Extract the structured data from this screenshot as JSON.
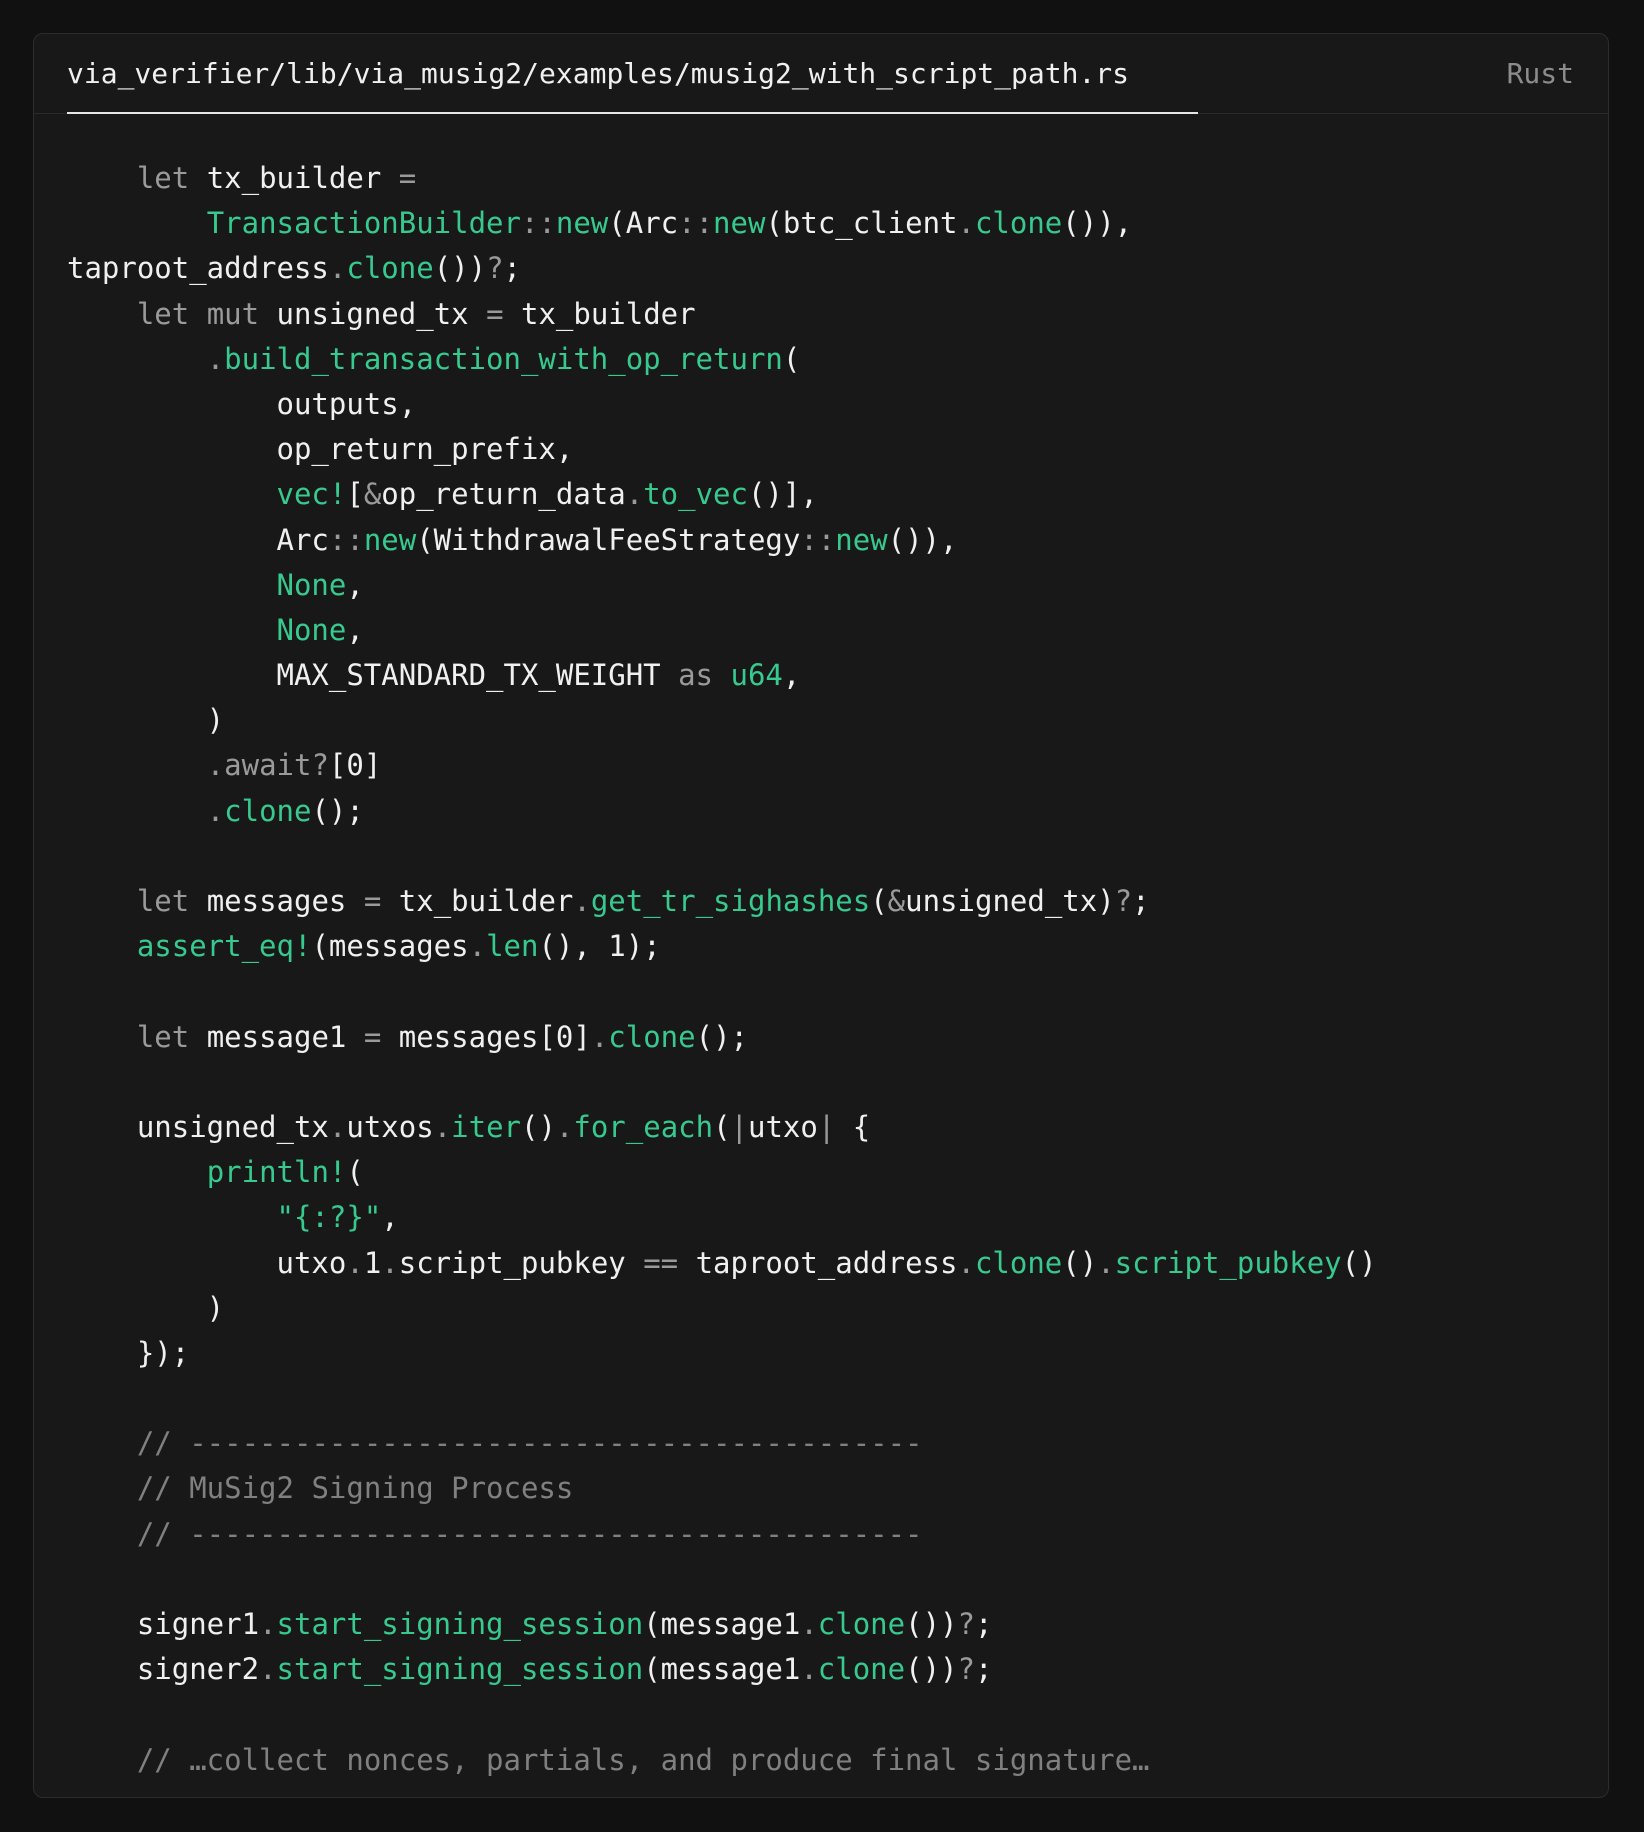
{
  "header": {
    "file_path": "via_verifier/lib/via_musig2/examples/musig2_with_script_path.rs",
    "language": "Rust"
  },
  "theme": {
    "background": "#111111",
    "panel": "#181818",
    "text": "#f0f0f0",
    "muted": "#9a9a9a",
    "accent": "#38c98e",
    "comment": "#808080"
  },
  "code_lines": [
    [
      [
        "    ",
        "t"
      ],
      [
        "let",
        "k"
      ],
      [
        " tx_builder ",
        "t"
      ],
      [
        "=",
        "p"
      ]
    ],
    [
      [
        "        ",
        "t"
      ],
      [
        "TransactionBuilder",
        "f"
      ],
      [
        "::",
        "p"
      ],
      [
        "new",
        "f"
      ],
      [
        "(Arc",
        "t"
      ],
      [
        "::",
        "p"
      ],
      [
        "new",
        "f"
      ],
      [
        "(btc_client",
        "t"
      ],
      [
        ".",
        "p"
      ],
      [
        "clone",
        "f"
      ],
      [
        "()),",
        "t"
      ]
    ],
    [
      [
        "taproot_address",
        "t"
      ],
      [
        ".",
        "p"
      ],
      [
        "clone",
        "f"
      ],
      [
        "())",
        "t"
      ],
      [
        "?",
        "p"
      ],
      [
        ";",
        "t"
      ]
    ],
    [
      [
        "    ",
        "t"
      ],
      [
        "let",
        "k"
      ],
      [
        " ",
        "t"
      ],
      [
        "mut",
        "k"
      ],
      [
        " unsigned_tx ",
        "t"
      ],
      [
        "=",
        "p"
      ],
      [
        " tx_builder",
        "t"
      ]
    ],
    [
      [
        "        ",
        "t"
      ],
      [
        ".",
        "p"
      ],
      [
        "build_transaction_with_op_return",
        "f"
      ],
      [
        "(",
        "t"
      ]
    ],
    [
      [
        "            outputs,",
        "t"
      ]
    ],
    [
      [
        "            op_return_prefix,",
        "t"
      ]
    ],
    [
      [
        "            ",
        "t"
      ],
      [
        "vec!",
        "f"
      ],
      [
        "[",
        "t"
      ],
      [
        "&",
        "p"
      ],
      [
        "op_return_data",
        "t"
      ],
      [
        ".",
        "p"
      ],
      [
        "to_vec",
        "f"
      ],
      [
        "()],",
        "t"
      ]
    ],
    [
      [
        "            Arc",
        "t"
      ],
      [
        "::",
        "p"
      ],
      [
        "new",
        "f"
      ],
      [
        "(WithdrawalFeeStrategy",
        "t"
      ],
      [
        "::",
        "p"
      ],
      [
        "new",
        "f"
      ],
      [
        "()),",
        "t"
      ]
    ],
    [
      [
        "            ",
        "t"
      ],
      [
        "None",
        "f"
      ],
      [
        ",",
        "t"
      ]
    ],
    [
      [
        "            ",
        "t"
      ],
      [
        "None",
        "f"
      ],
      [
        ",",
        "t"
      ]
    ],
    [
      [
        "            MAX_STANDARD_TX_WEIGHT ",
        "t"
      ],
      [
        "as",
        "k"
      ],
      [
        " ",
        "t"
      ],
      [
        "u64",
        "f"
      ],
      [
        ",",
        "t"
      ]
    ],
    [
      [
        "        )",
        "t"
      ]
    ],
    [
      [
        "        ",
        "t"
      ],
      [
        ".await?",
        "k"
      ],
      [
        "[0]",
        "t"
      ]
    ],
    [
      [
        "        ",
        "t"
      ],
      [
        ".",
        "p"
      ],
      [
        "clone",
        "f"
      ],
      [
        "();",
        "t"
      ]
    ],
    [
      [
        "",
        "t"
      ]
    ],
    [
      [
        "    ",
        "t"
      ],
      [
        "let",
        "k"
      ],
      [
        " messages ",
        "t"
      ],
      [
        "=",
        "p"
      ],
      [
        " tx_builder",
        "t"
      ],
      [
        ".",
        "p"
      ],
      [
        "get_tr_sighashes",
        "f"
      ],
      [
        "(",
        "t"
      ],
      [
        "&",
        "p"
      ],
      [
        "unsigned_tx)",
        "t"
      ],
      [
        "?",
        "p"
      ],
      [
        ";",
        "t"
      ]
    ],
    [
      [
        "    ",
        "t"
      ],
      [
        "assert_eq!",
        "f"
      ],
      [
        "(messages",
        "t"
      ],
      [
        ".",
        "p"
      ],
      [
        "len",
        "f"
      ],
      [
        "(), 1);",
        "t"
      ]
    ],
    [
      [
        "",
        "t"
      ]
    ],
    [
      [
        "    ",
        "t"
      ],
      [
        "let",
        "k"
      ],
      [
        " message1 ",
        "t"
      ],
      [
        "=",
        "p"
      ],
      [
        " messages[0]",
        "t"
      ],
      [
        ".",
        "p"
      ],
      [
        "clone",
        "f"
      ],
      [
        "();",
        "t"
      ]
    ],
    [
      [
        "",
        "t"
      ]
    ],
    [
      [
        "    unsigned_tx",
        "t"
      ],
      [
        ".",
        "p"
      ],
      [
        "utxos",
        "t"
      ],
      [
        ".",
        "p"
      ],
      [
        "iter",
        "f"
      ],
      [
        "()",
        "t"
      ],
      [
        ".",
        "p"
      ],
      [
        "for_each",
        "f"
      ],
      [
        "(",
        "t"
      ],
      [
        "|",
        "p"
      ],
      [
        "utxo",
        "t"
      ],
      [
        "|",
        "p"
      ],
      [
        " {",
        "t"
      ]
    ],
    [
      [
        "        ",
        "t"
      ],
      [
        "println!",
        "f"
      ],
      [
        "(",
        "t"
      ]
    ],
    [
      [
        "            ",
        "t"
      ],
      [
        "\"{:?}\"",
        "s"
      ],
      [
        ",",
        "t"
      ]
    ],
    [
      [
        "            utxo",
        "t"
      ],
      [
        ".",
        "p"
      ],
      [
        "1",
        "t"
      ],
      [
        ".",
        "p"
      ],
      [
        "script_pubkey ",
        "t"
      ],
      [
        "==",
        "p"
      ],
      [
        " taproot_address",
        "t"
      ],
      [
        ".",
        "p"
      ],
      [
        "clone",
        "f"
      ],
      [
        "()",
        "t"
      ],
      [
        ".",
        "p"
      ],
      [
        "script_pubkey",
        "f"
      ],
      [
        "()",
        "t"
      ]
    ],
    [
      [
        "        )",
        "t"
      ]
    ],
    [
      [
        "    });",
        "t"
      ]
    ],
    [
      [
        "",
        "t"
      ]
    ],
    [
      [
        "    ",
        "t"
      ],
      [
        "// ------------------------------------------",
        "c"
      ]
    ],
    [
      [
        "    ",
        "t"
      ],
      [
        "// MuSig2 Signing Process",
        "c"
      ]
    ],
    [
      [
        "    ",
        "t"
      ],
      [
        "// ------------------------------------------",
        "c"
      ]
    ],
    [
      [
        "",
        "t"
      ]
    ],
    [
      [
        "    signer1",
        "t"
      ],
      [
        ".",
        "p"
      ],
      [
        "start_signing_session",
        "f"
      ],
      [
        "(message1",
        "t"
      ],
      [
        ".",
        "p"
      ],
      [
        "clone",
        "f"
      ],
      [
        "())",
        "t"
      ],
      [
        "?",
        "p"
      ],
      [
        ";",
        "t"
      ]
    ],
    [
      [
        "    signer2",
        "t"
      ],
      [
        ".",
        "p"
      ],
      [
        "start_signing_session",
        "f"
      ],
      [
        "(message1",
        "t"
      ],
      [
        ".",
        "p"
      ],
      [
        "clone",
        "f"
      ],
      [
        "())",
        "t"
      ],
      [
        "?",
        "p"
      ],
      [
        ";",
        "t"
      ]
    ],
    [
      [
        "",
        "t"
      ]
    ],
    [
      [
        "    ",
        "t"
      ],
      [
        "// …collect nonces, partials, and produce final signature…",
        "c"
      ]
    ]
  ]
}
